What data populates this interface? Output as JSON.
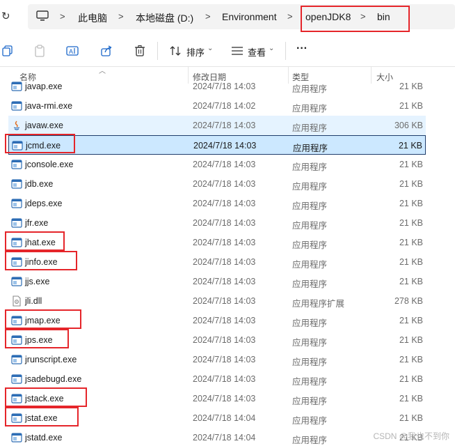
{
  "breadcrumb": {
    "items": [
      "此电脑",
      "本地磁盘 (D:)",
      "Environment",
      "openJDK8",
      "bin"
    ]
  },
  "toolbar": {
    "sort_label": "排序",
    "view_label": "查看",
    "more_label": "···"
  },
  "columns": {
    "name": "名称",
    "date": "修改日期",
    "type": "类型",
    "size": "大小"
  },
  "files": [
    {
      "name": "javap.exe",
      "date": "2024/7/18 14:03",
      "type": "应用程序",
      "size": "21 KB",
      "icon": "exe-icon"
    },
    {
      "name": "java-rmi.exe",
      "date": "2024/7/18 14:02",
      "type": "应用程序",
      "size": "21 KB",
      "icon": "exe-icon"
    },
    {
      "name": "javaw.exe",
      "date": "2024/7/18 14:03",
      "type": "应用程序",
      "size": "306 KB",
      "icon": "java-icon"
    },
    {
      "name": "jcmd.exe",
      "date": "2024/7/18 14:03",
      "type": "应用程序",
      "size": "21 KB",
      "icon": "exe-icon",
      "selected": true
    },
    {
      "name": "jconsole.exe",
      "date": "2024/7/18 14:03",
      "type": "应用程序",
      "size": "21 KB",
      "icon": "exe-icon"
    },
    {
      "name": "jdb.exe",
      "date": "2024/7/18 14:03",
      "type": "应用程序",
      "size": "21 KB",
      "icon": "exe-icon"
    },
    {
      "name": "jdeps.exe",
      "date": "2024/7/18 14:03",
      "type": "应用程序",
      "size": "21 KB",
      "icon": "exe-icon"
    },
    {
      "name": "jfr.exe",
      "date": "2024/7/18 14:03",
      "type": "应用程序",
      "size": "21 KB",
      "icon": "exe-icon"
    },
    {
      "name": "jhat.exe",
      "date": "2024/7/18 14:03",
      "type": "应用程序",
      "size": "21 KB",
      "icon": "exe-icon"
    },
    {
      "name": "jinfo.exe",
      "date": "2024/7/18 14:03",
      "type": "应用程序",
      "size": "21 KB",
      "icon": "exe-icon"
    },
    {
      "name": "jjs.exe",
      "date": "2024/7/18 14:03",
      "type": "应用程序",
      "size": "21 KB",
      "icon": "exe-icon"
    },
    {
      "name": "jli.dll",
      "date": "2024/7/18 14:03",
      "type": "应用程序扩展",
      "size": "278 KB",
      "icon": "dll-icon"
    },
    {
      "name": "jmap.exe",
      "date": "2024/7/18 14:03",
      "type": "应用程序",
      "size": "21 KB",
      "icon": "exe-icon"
    },
    {
      "name": "jps.exe",
      "date": "2024/7/18 14:03",
      "type": "应用程序",
      "size": "21 KB",
      "icon": "exe-icon"
    },
    {
      "name": "jrunscript.exe",
      "date": "2024/7/18 14:03",
      "type": "应用程序",
      "size": "21 KB",
      "icon": "exe-icon"
    },
    {
      "name": "jsadebugd.exe",
      "date": "2024/7/18 14:03",
      "type": "应用程序",
      "size": "21 KB",
      "icon": "exe-icon"
    },
    {
      "name": "jstack.exe",
      "date": "2024/7/18 14:03",
      "type": "应用程序",
      "size": "21 KB",
      "icon": "exe-icon"
    },
    {
      "name": "jstat.exe",
      "date": "2024/7/18 14:04",
      "type": "应用程序",
      "size": "21 KB",
      "icon": "exe-icon"
    },
    {
      "name": "jstatd.exe",
      "date": "2024/7/18 14:04",
      "type": "应用程序",
      "size": "21 KB",
      "icon": "exe-icon"
    }
  ],
  "watermark": "CSDN @我也不到你",
  "colors": {
    "highlight": "#e5252a",
    "selection": "#cce8ff",
    "hover": "#e5f3ff"
  }
}
